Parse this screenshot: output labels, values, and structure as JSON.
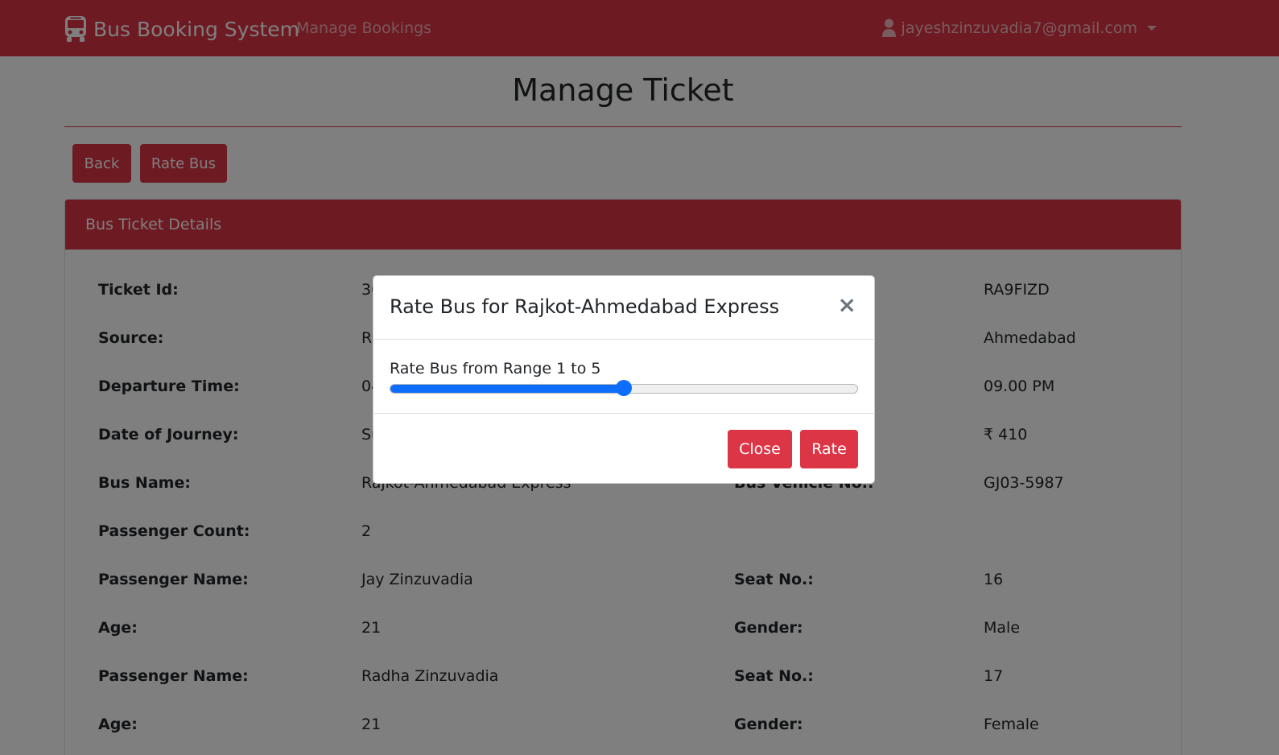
{
  "navbar": {
    "brand": "Bus Booking System",
    "brand_icon": "bus-icon",
    "nav_link": "Manage Bookings",
    "user_email": "jayeshzinzuvadia7@gmail.com",
    "user_icon": "user-icon"
  },
  "page": {
    "title": "Manage Ticket",
    "back_label": "Back",
    "rate_bus_label": "Rate Bus"
  },
  "card": {
    "header": "Bus Ticket Details",
    "rows": [
      {
        "l1": "Ticket Id:",
        "v1": "30",
        "l2": "",
        "v2": "RA9FIZD"
      },
      {
        "l1": "Source:",
        "v1": "R",
        "l2": "",
        "v2": "Ahmedabad"
      },
      {
        "l1": "Departure Time:",
        "v1": "04",
        "l2": "",
        "v2": "09.00 PM"
      },
      {
        "l1": "Date of Journey:",
        "v1": "Su",
        "l2": "",
        "v2": "₹ 410"
      },
      {
        "l1": "Bus Name:",
        "v1": "Rajkot-Ahmedabad Express",
        "l2": "Bus Vehicle No.:",
        "v2": "GJ03-5987"
      },
      {
        "l1": "Passenger Count:",
        "v1": "2",
        "l2": "",
        "v2": ""
      },
      {
        "l1": "Passenger Name:",
        "v1": "Jay Zinzuvadia",
        "l2": "Seat No.:",
        "v2": "16"
      },
      {
        "l1": "Age:",
        "v1": "21",
        "l2": "Gender:",
        "v2": "Male"
      },
      {
        "l1": "Passenger Name:",
        "v1": "Radha Zinzuvadia",
        "l2": "Seat No.:",
        "v2": "17"
      },
      {
        "l1": "Age:",
        "v1": "21",
        "l2": "Gender:",
        "v2": "Female"
      }
    ]
  },
  "modal": {
    "title": "Rate Bus for Rajkot-Ahmedabad Express",
    "close_symbol": "×",
    "range_label": "Rate Bus from Range 1 to 5",
    "range_min": 1,
    "range_max": 5,
    "range_value": 3,
    "close_label": "Close",
    "rate_label": "Rate"
  },
  "colors": {
    "brand": "#dc3545",
    "range_accent": "#0d6efd"
  }
}
